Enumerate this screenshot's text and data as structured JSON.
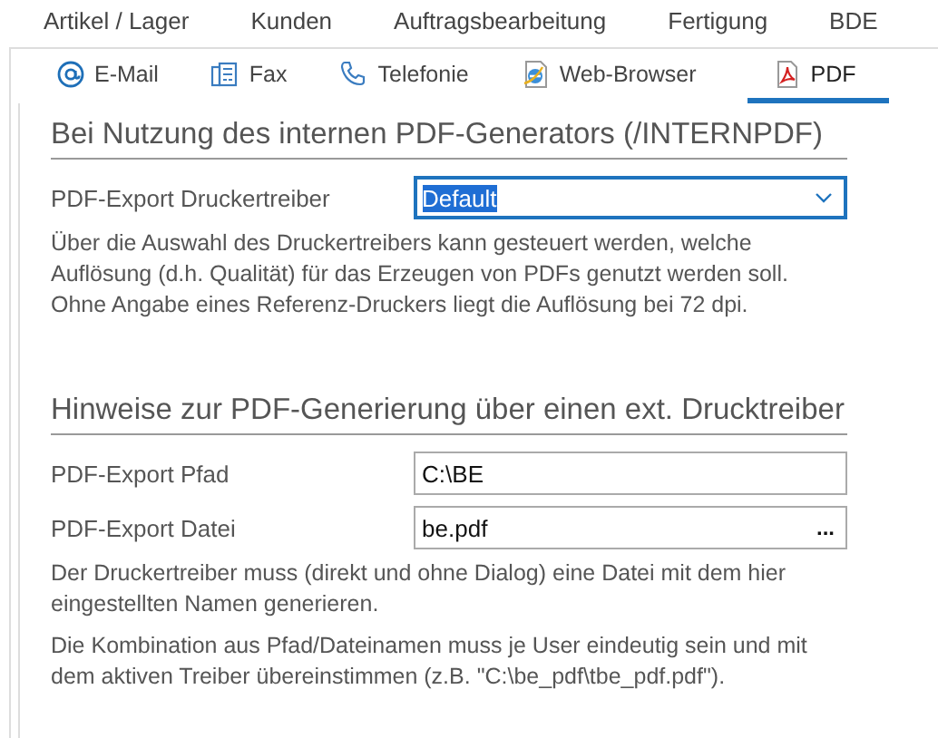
{
  "menu": [
    {
      "label": "Artikel / Lager"
    },
    {
      "label": "Kunden"
    },
    {
      "label": "Auftragsbearbeitung"
    },
    {
      "label": "Fertigung"
    },
    {
      "label": "BDE"
    }
  ],
  "tabs": [
    {
      "label": "E-Mail",
      "kind": "email",
      "selected": false
    },
    {
      "label": "Fax",
      "kind": "fax",
      "selected": false
    },
    {
      "label": "Telefonie",
      "kind": "phone",
      "selected": false
    },
    {
      "label": "Web-Browser",
      "kind": "browser",
      "selected": false
    },
    {
      "label": "PDF",
      "kind": "pdf",
      "selected": true
    }
  ],
  "sections": [
    {
      "title": "Bei Nutzung des internen PDF-Generators (/INTERNPDF)",
      "fields": [
        {
          "label": "PDF-Export Druckertreiber",
          "kind": "dropdown",
          "value": "Default",
          "focused": true
        }
      ],
      "notes": [
        "Über die Auswahl des Druckertreibers kann gesteuert werden, welche Auflösung (d.h. Qualität) für das Erzeugen von PDFs genutzt werden soll. Ohne Angabe eines Referenz-Druckers liegt die Auflösung bei 72 dpi."
      ]
    },
    {
      "title": "Hinweise zur PDF-Generierung über einen ext. Drucktreiber",
      "fields": [
        {
          "label": "PDF-Export Pfad",
          "kind": "text",
          "value": "C:\\BE",
          "focused": false
        },
        {
          "label": "PDF-Export Datei",
          "kind": "file",
          "value": "be.pdf",
          "button": "...",
          "focused": false
        }
      ],
      "notes": [
        "Der Druckertreiber muss (direkt und ohne Dialog) eine Datei mit dem hier eingestellten Namen generieren.",
        "Die Kombination aus Pfad/Dateinamen muss je User eindeutig sein und mit dem aktiven Treiber übereinstimmen (z.B. \"C:\\be_pdf\\tbe_pdf.pdf\")."
      ]
    }
  ]
}
